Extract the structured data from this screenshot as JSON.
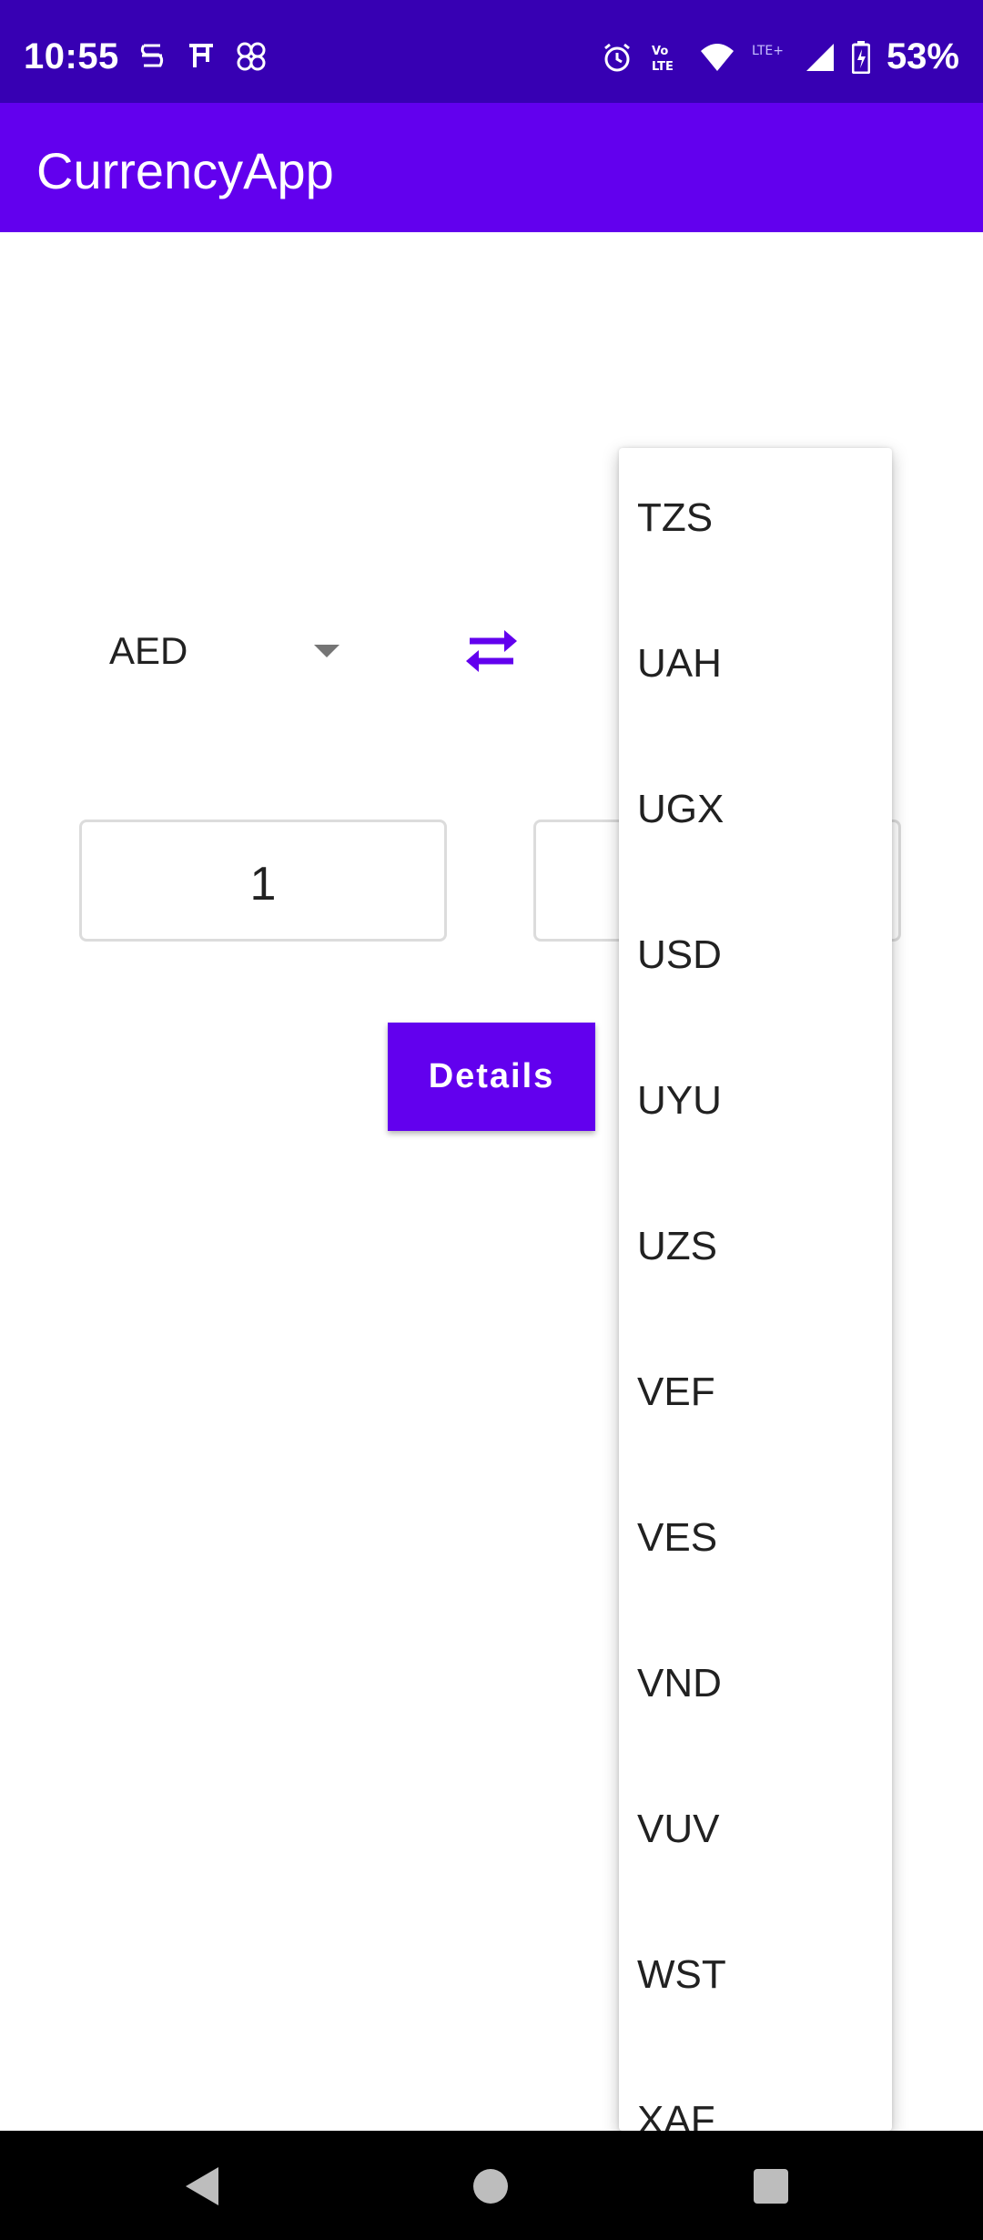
{
  "status_bar": {
    "time": "10:55",
    "left_icons": [
      "s-icon",
      "font-icon",
      "pinwheel-icon"
    ],
    "right_icons": [
      "alarm-icon",
      "volte-icon",
      "wifi-icon",
      "lte-plus-icon",
      "signal-icon",
      "battery-charging-icon"
    ],
    "battery": "53%"
  },
  "app_bar": {
    "title": "CurrencyApp"
  },
  "converter": {
    "from_currency": "AED",
    "swap_icon": "swap-arrows-icon",
    "amount_from": "1",
    "amount_to": "",
    "details_label": "Details"
  },
  "dropdown": {
    "items": [
      "TZS",
      "UAH",
      "UGX",
      "USD",
      "UYU",
      "UZS",
      "VEF",
      "VES",
      "VND",
      "VUV",
      "WST",
      "XAF"
    ]
  },
  "nav_bar": {
    "icons": [
      "back-icon",
      "home-icon",
      "recents-icon"
    ]
  },
  "colors": {
    "status_bar": "#3700B3",
    "primary": "#6200EE"
  }
}
